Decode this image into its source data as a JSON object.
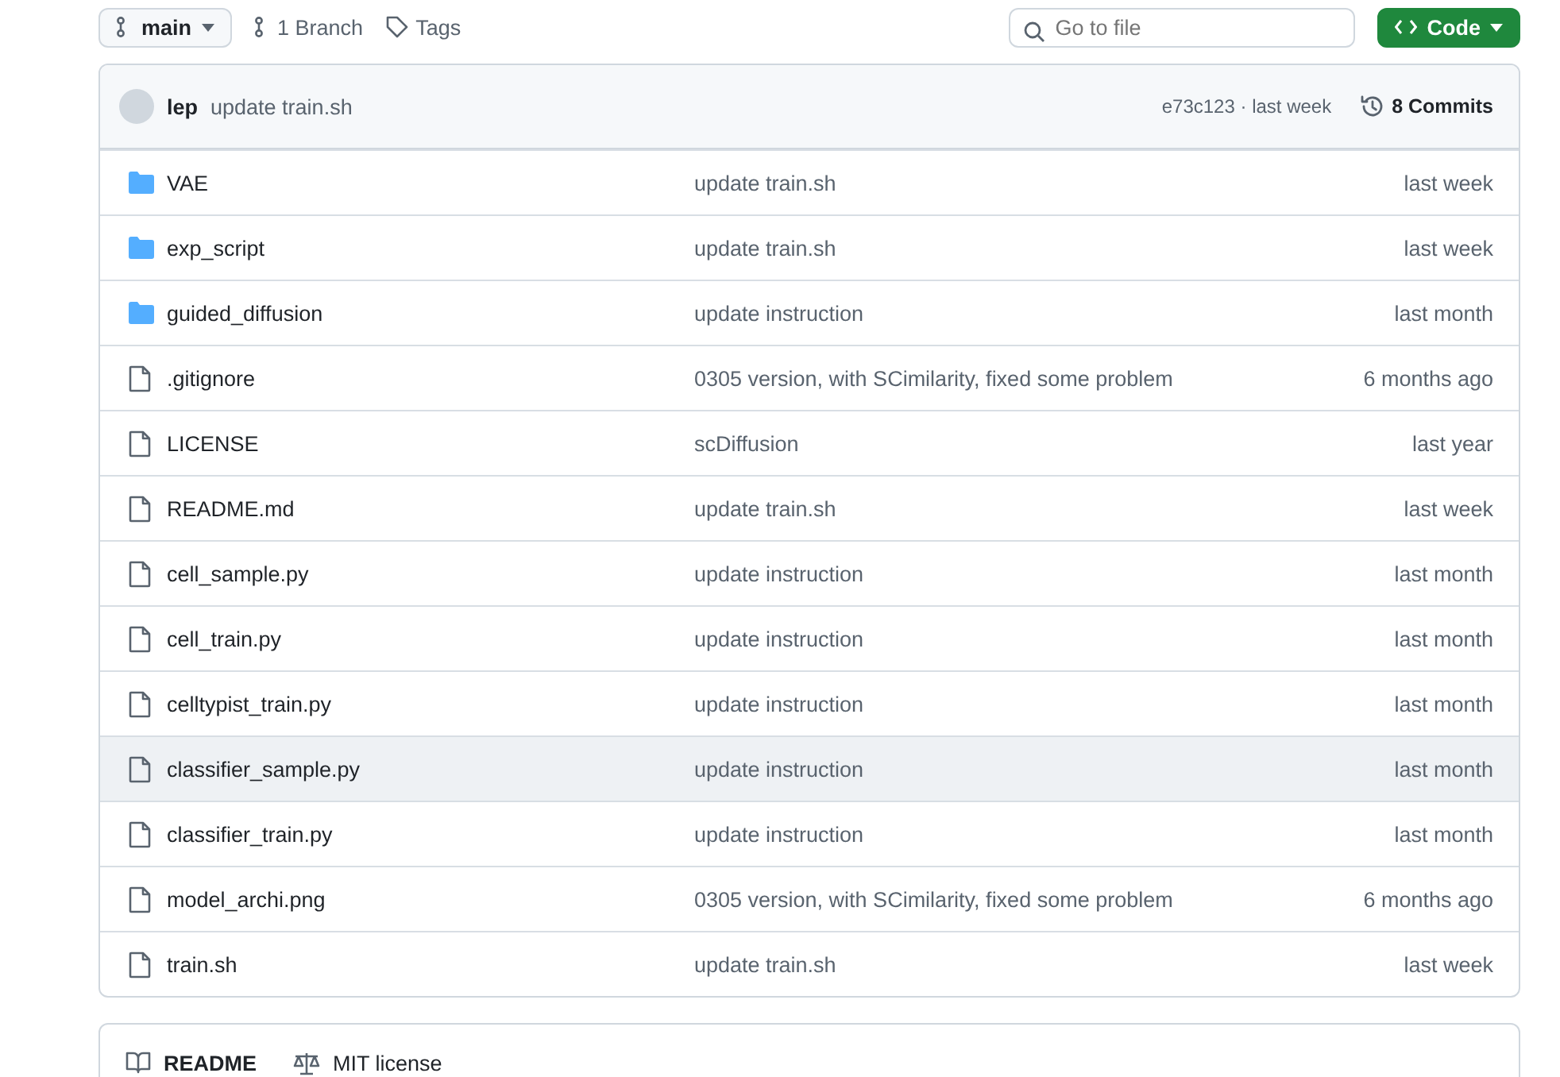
{
  "toolbar": {
    "branch": "main",
    "branches": "1 Branch",
    "tags": "Tags",
    "search": {
      "placeholder": "Go to file"
    },
    "code_button": "Code"
  },
  "latest_commit": {
    "author": "lep",
    "message": "update train.sh",
    "hash": "e73c123 · last week",
    "commits": "8 Commits"
  },
  "files": [
    {
      "kind": "folder",
      "name": "VAE",
      "message": "update train.sh",
      "date": "last week",
      "selected": false
    },
    {
      "kind": "folder",
      "name": "exp_script",
      "message": "update train.sh",
      "date": "last week",
      "selected": false
    },
    {
      "kind": "folder",
      "name": "guided_diffusion",
      "message": "update instruction",
      "date": "last month",
      "selected": false
    },
    {
      "kind": "file",
      "name": ".gitignore",
      "message": "0305 version, with SCimilarity, fixed some problem",
      "date": "6 months ago",
      "selected": false
    },
    {
      "kind": "file",
      "name": "LICENSE",
      "message": "scDiffusion",
      "date": "last year",
      "selected": false
    },
    {
      "kind": "file",
      "name": "README.md",
      "message": "update train.sh",
      "date": "last week",
      "selected": false
    },
    {
      "kind": "file",
      "name": "cell_sample.py",
      "message": "update instruction",
      "date": "last month",
      "selected": false
    },
    {
      "kind": "file",
      "name": "cell_train.py",
      "message": "update instruction",
      "date": "last month",
      "selected": false
    },
    {
      "kind": "file",
      "name": "celltypist_train.py",
      "message": "update instruction",
      "date": "last month",
      "selected": false
    },
    {
      "kind": "file",
      "name": "classifier_sample.py",
      "message": "update instruction",
      "date": "last month",
      "selected": true
    },
    {
      "kind": "file",
      "name": "classifier_train.py",
      "message": "update instruction",
      "date": "last month",
      "selected": false
    },
    {
      "kind": "file",
      "name": "model_archi.png",
      "message": "0305 version, with SCimilarity, fixed some problem",
      "date": "6 months ago",
      "selected": false
    },
    {
      "kind": "file",
      "name": "train.sh",
      "message": "update train.sh",
      "date": "last week",
      "selected": false
    }
  ],
  "readme_tabs": [
    {
      "kind": "readme",
      "label": "README"
    },
    {
      "kind": "license",
      "label": "MIT license"
    }
  ]
}
